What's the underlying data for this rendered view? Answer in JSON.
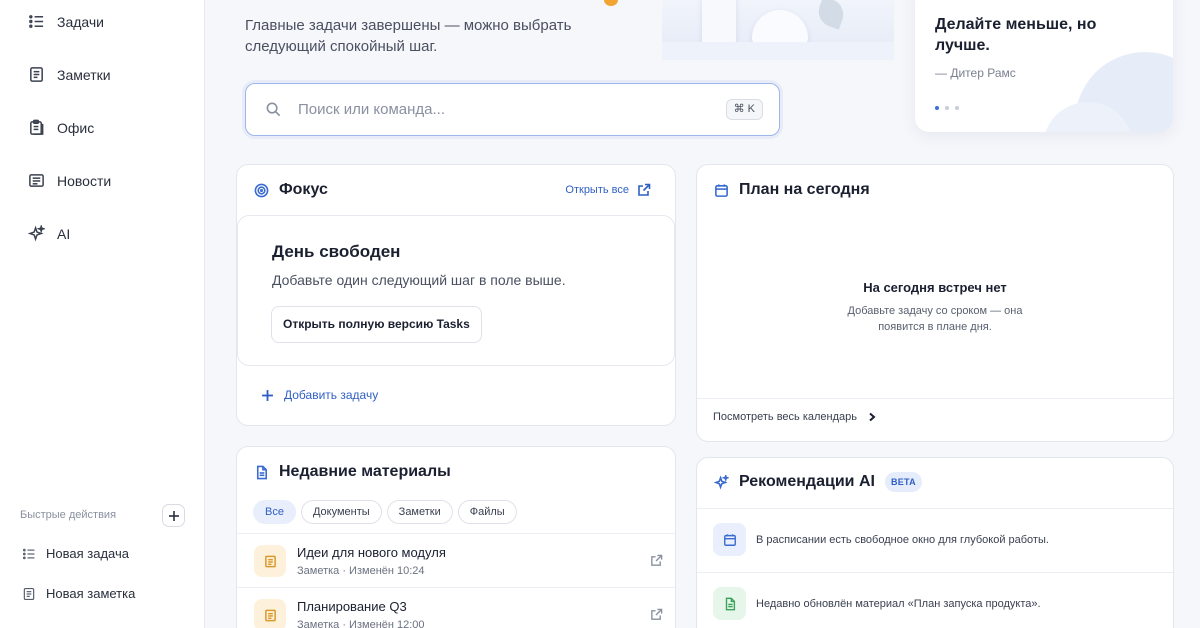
{
  "sidebar": {
    "nav": [
      {
        "label": "Задачи",
        "icon": "list-icon"
      },
      {
        "label": "Заметки",
        "icon": "note-icon"
      },
      {
        "label": "Офис",
        "icon": "clipboard-icon"
      },
      {
        "label": "Новости",
        "icon": "newspaper-icon"
      },
      {
        "label": "AI",
        "icon": "sparkles-icon"
      }
    ],
    "quick_actions_title": "Быстрые действия",
    "quick_actions": [
      {
        "label": "Новая задача",
        "icon": "list-icon"
      },
      {
        "label": "Новая заметка",
        "icon": "note-icon"
      }
    ]
  },
  "hero": {
    "subtitle": "Главные задачи завершены — можно выбрать следующий спокойный шаг."
  },
  "quote": {
    "text": "Делайте меньше, но лучше.",
    "author": "— Дитер Рамс"
  },
  "search": {
    "placeholder": "Поиск или команда...",
    "shortcut": "⌘ K"
  },
  "focus": {
    "title": "Фокус",
    "open_all": "Открыть все",
    "empty_title": "День свободен",
    "empty_subtitle": "Добавьте один следующий шаг в поле выше.",
    "open_full_button": "Открыть полную версию Tasks",
    "add_task": "Добавить задачу"
  },
  "plan": {
    "title": "План на сегодня",
    "empty_title": "На сегодня встреч нет",
    "empty_subtitle": "Добавьте задачу со сроком — она появится в плане дня.",
    "calendar_link": "Посмотреть весь календарь"
  },
  "recent": {
    "title": "Недавние материалы",
    "filters": [
      "Все",
      "Документы",
      "Заметки",
      "Файлы"
    ],
    "active_filter": "Все",
    "items": [
      {
        "title": "Идеи для нового модуля",
        "meta": "Заметка · Изменён 10:24"
      },
      {
        "title": "Планирование Q3",
        "meta": "Заметка · Изменён 12:00"
      }
    ]
  },
  "ai": {
    "title": "Рекомендации AI",
    "badge": "BETA",
    "items": [
      {
        "text": "В расписании есть свободное окно для глубокой работы.",
        "icon": "calendar-icon"
      },
      {
        "text": "Недавно обновлён материал «План запуска продукта».",
        "icon": "document-icon"
      }
    ]
  },
  "colors": {
    "accent": "#2f5fc4",
    "highlight_dot": "#f3a533"
  }
}
